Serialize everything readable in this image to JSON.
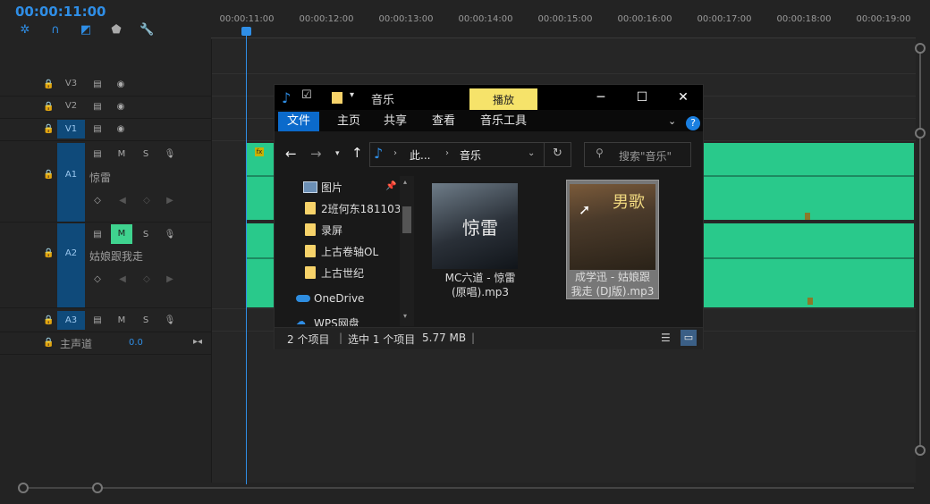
{
  "timeline": {
    "timecode": "00:00:11:00",
    "ruler": [
      "00:00:11:00",
      "00:00:12:00",
      "00:00:13:00",
      "00:00:14:00",
      "00:00:15:00",
      "00:00:16:00",
      "00:00:17:00",
      "00:00:18:00",
      "00:00:19:00"
    ],
    "tools": [
      "snap-icon",
      "linked-selection-icon",
      "marker-icon",
      "add-marker-icon",
      "wrench-icon"
    ],
    "tracks": {
      "v3": "V3",
      "v2": "V2",
      "v1": "V1",
      "a1": "A1",
      "a1_name": "惊雷",
      "a2": "A2",
      "a2_name": "姑娘跟我走",
      "a3": "A3",
      "master": "主声道",
      "master_value": "0.0"
    },
    "buttons": {
      "m": "M",
      "s": "S"
    },
    "colors": {
      "accent": "#2f8ee6",
      "clip": "#29c98b",
      "mute_on": "#3fd38f"
    }
  },
  "explorer": {
    "title": "音乐",
    "context_tab": "播放",
    "tabs": [
      "文件",
      "主页",
      "共享",
      "查看",
      "音乐工具"
    ],
    "address": {
      "part1": "此...",
      "part2": "音乐"
    },
    "search_placeholder": "搜索\"音乐\"",
    "nav": [
      "图片",
      "2班何东181103",
      "录屏",
      "上古卷轴OL",
      "上古世纪",
      "OneDrive",
      "WPS网盘"
    ],
    "files": [
      {
        "line1": "MC六道 - 惊雷",
        "line2": "(原唱).mp3",
        "cover_text": "惊雷"
      },
      {
        "line1": "成学迅 - 姑娘跟",
        "line2": "我走 (DJ版).mp3",
        "cover_text": "男歌"
      }
    ],
    "status": {
      "count": "2 个项目",
      "selected": "选中 1 个项目",
      "size": "5.77 MB"
    }
  }
}
